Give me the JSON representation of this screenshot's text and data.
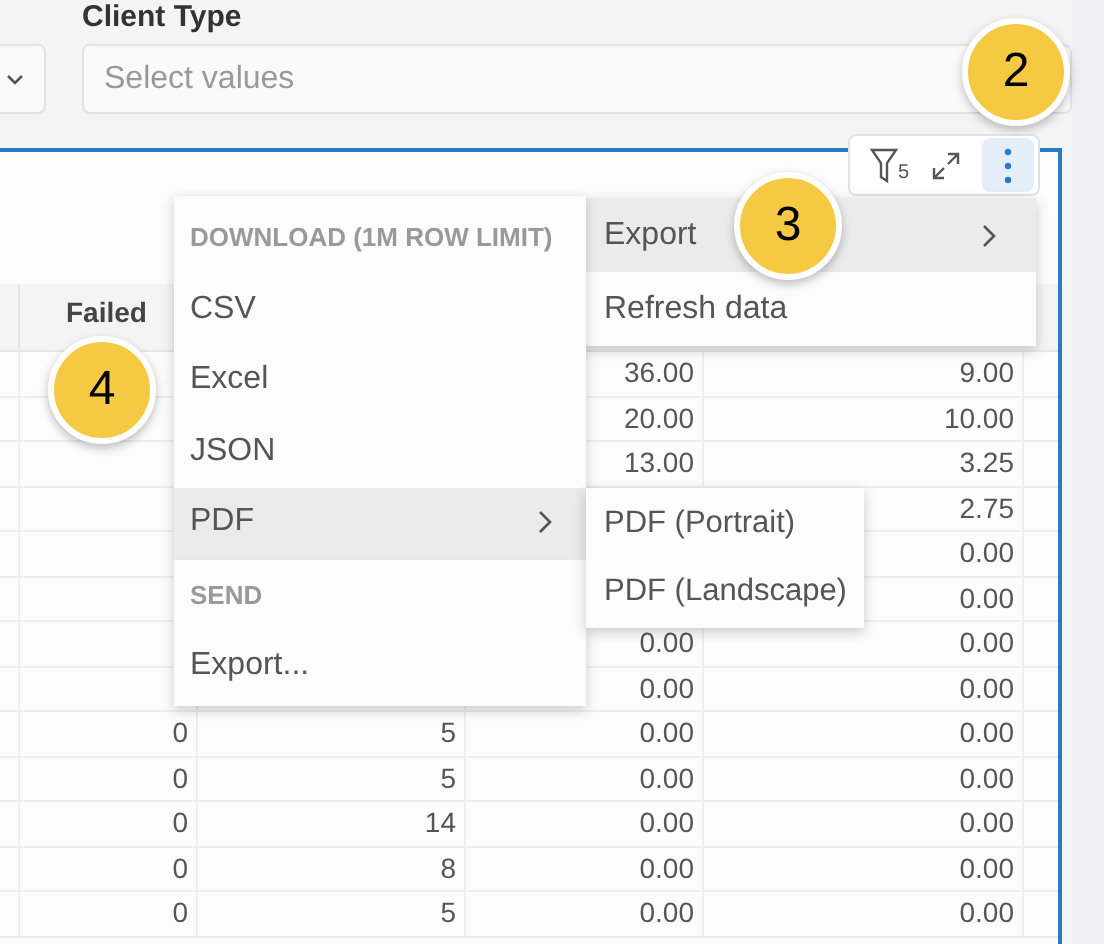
{
  "filter": {
    "label": "Client Type",
    "placeholder": "Select values"
  },
  "toolbar": {
    "filter_count": "5"
  },
  "table": {
    "header": "Failed",
    "rows": [
      [
        null,
        null,
        null,
        "36.00",
        "9.00"
      ],
      [
        null,
        null,
        null,
        "20.00",
        "10.00"
      ],
      [
        null,
        null,
        null,
        "13.00",
        "3.25"
      ],
      [
        null,
        null,
        null,
        null,
        "2.75"
      ],
      [
        null,
        null,
        null,
        null,
        "0.00"
      ],
      [
        null,
        null,
        null,
        null,
        "0.00"
      ],
      [
        null,
        null,
        null,
        "0.00",
        "0.00"
      ],
      [
        null,
        null,
        null,
        "0.00",
        "0.00"
      ],
      [
        null,
        "0",
        "5",
        "0.00",
        "0.00"
      ],
      [
        null,
        "0",
        "5",
        "0.00",
        "0.00"
      ],
      [
        null,
        "0",
        "14",
        "0.00",
        "0.00"
      ],
      [
        null,
        "0",
        "8",
        "0.00",
        "0.00"
      ],
      [
        null,
        "0",
        "5",
        "0.00",
        "0.00"
      ]
    ]
  },
  "menu": {
    "items": [
      {
        "label": "Export",
        "submenu": true,
        "highlighted": true
      },
      {
        "label": "Refresh data",
        "submenu": false,
        "highlighted": false
      }
    ]
  },
  "export_menu": {
    "items": [
      {
        "kind": "header",
        "label": "DOWNLOAD (1M ROW LIMIT)"
      },
      {
        "kind": "item",
        "label": "CSV",
        "submenu": false,
        "highlighted": false
      },
      {
        "kind": "item",
        "label": "Excel",
        "submenu": false,
        "highlighted": false
      },
      {
        "kind": "item",
        "label": "JSON",
        "submenu": false,
        "highlighted": false
      },
      {
        "kind": "item",
        "label": "PDF",
        "submenu": true,
        "highlighted": true
      },
      {
        "kind": "header",
        "label": "SEND"
      },
      {
        "kind": "item",
        "label": "Export...",
        "submenu": false,
        "highlighted": false
      }
    ]
  },
  "pdf_menu": {
    "items": [
      {
        "label": "PDF (Portrait)"
      },
      {
        "label": "PDF (Landscape)"
      }
    ]
  },
  "callouts": [
    {
      "number": "2"
    },
    {
      "number": "3"
    },
    {
      "number": "4"
    }
  ]
}
